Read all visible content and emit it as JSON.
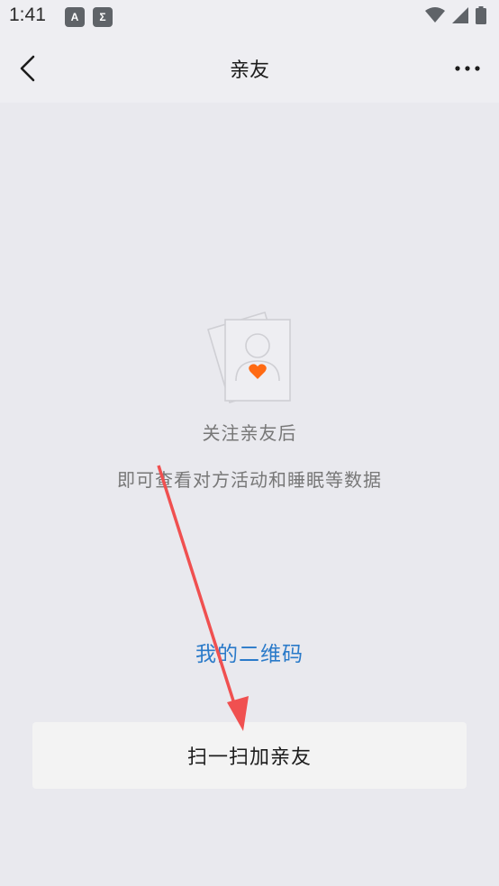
{
  "status_bar": {
    "time": "1:41",
    "notif_icons": [
      "A",
      "Σ"
    ],
    "signal_icons": [
      "wifi-icon",
      "signal-icon",
      "battery-icon"
    ]
  },
  "app_bar": {
    "title": "亲友",
    "back_icon": "chevron-left-icon",
    "more_icon": "more-horizontal-icon"
  },
  "empty_state": {
    "illustration_icon": "friend-card-heart-icon",
    "heart_color": "#ff6a13",
    "title": "关注亲友后",
    "subtitle": "即可查看对方活动和睡眠等数据"
  },
  "actions": {
    "qr_link": "我的二维码",
    "scan_button": "扫一扫加亲友"
  },
  "colors": {
    "background": "#e9e9ee",
    "link": "#2a7ac9",
    "annotation_arrow": "#f05050"
  }
}
